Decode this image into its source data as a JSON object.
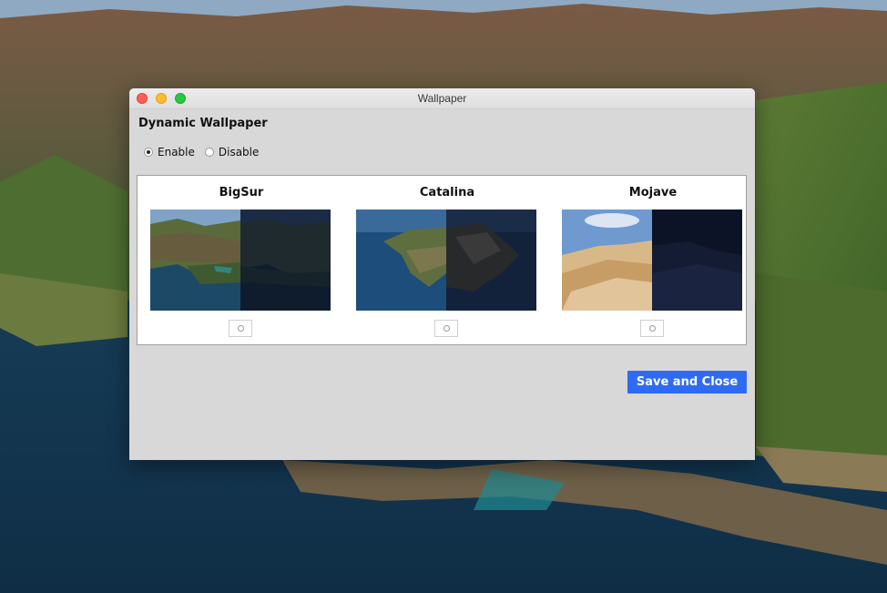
{
  "window": {
    "title": "Wallpaper"
  },
  "section": {
    "title": "Dynamic Wallpaper"
  },
  "mode": {
    "options": [
      {
        "label": "Enable",
        "checked": true
      },
      {
        "label": "Disable",
        "checked": false
      }
    ]
  },
  "wallpapers": [
    {
      "name": "BigSur",
      "selected": false
    },
    {
      "name": "Catalina",
      "selected": false
    },
    {
      "name": "Mojave",
      "selected": false
    }
  ],
  "actions": {
    "save_label": "Save and Close"
  },
  "colors": {
    "accent": "#2f6bf2",
    "window_bg": "#d8d8d8",
    "close": "#fe5f57",
    "minimize": "#febc2e",
    "maximize": "#28c840"
  }
}
